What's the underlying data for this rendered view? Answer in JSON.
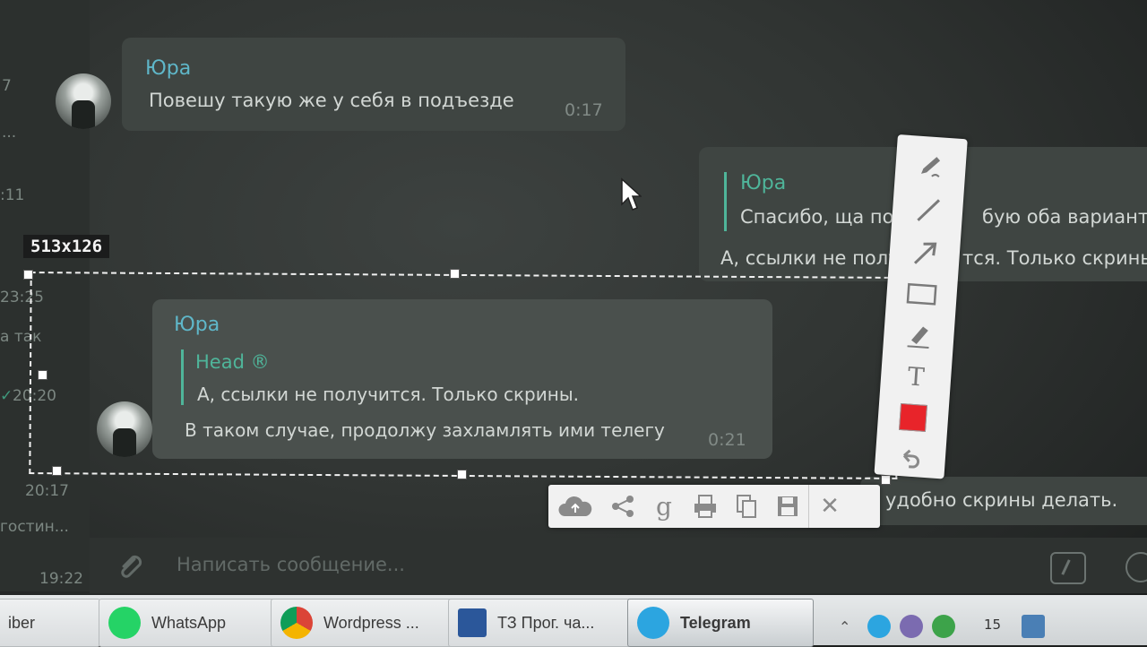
{
  "left_list": {
    "items": [
      "7",
      "...",
      ":11",
      "23:25",
      "а так",
      "20:20",
      "20:17",
      "гостин...",
      "19:22"
    ]
  },
  "messages": [
    {
      "author": "Юра",
      "text": "Повешу такую же у себя в подъезде",
      "time": "0:17"
    },
    {
      "quote_author": "Юра",
      "quote_text": "Спасибо, ща по",
      "quote_text_tail": "бую оба вариант",
      "text": "А, ссылки не полу",
      "text_tail": "тся. Только скрины"
    },
    {
      "author": "Юра",
      "quote_author": "Head ®",
      "quote_text": "А, ссылки не получится. Только скрины.",
      "text": "В таком случае, продолжу захламлять ими телегу",
      "time": "0:21"
    },
    {
      "text": "удобно скрины делать."
    }
  ],
  "selection": {
    "size_label": "513x126"
  },
  "vertical_toolbar": {
    "tools": [
      "pen-icon",
      "line-icon",
      "arrow-icon",
      "rectangle-icon",
      "marker-icon",
      "text-icon",
      "color-swatch",
      "undo-icon"
    ],
    "text_tool_glyph": "T",
    "color": "#e8242a"
  },
  "horizontal_toolbar": {
    "tools": [
      "upload-cloud-icon",
      "share-icon",
      "google-search-icon",
      "print-icon",
      "copy-icon",
      "save-icon",
      "close-icon"
    ],
    "google_glyph": "g",
    "close_glyph": "✕"
  },
  "composer": {
    "placeholder": "Написать сообщение..."
  },
  "taskbar": {
    "items": [
      {
        "label": "iber",
        "icon": "viber-icon"
      },
      {
        "label": "WhatsApp",
        "icon": "whatsapp-icon",
        "color": "#25d366"
      },
      {
        "label": "Wordpress ...",
        "icon": "chrome-icon"
      },
      {
        "label": "ТЗ Прог. ча...",
        "icon": "word-icon",
        "color": "#2b579a"
      },
      {
        "label": "Telegram",
        "icon": "telegram-icon",
        "color": "#2ca5e0"
      }
    ],
    "tray_number": "15"
  }
}
